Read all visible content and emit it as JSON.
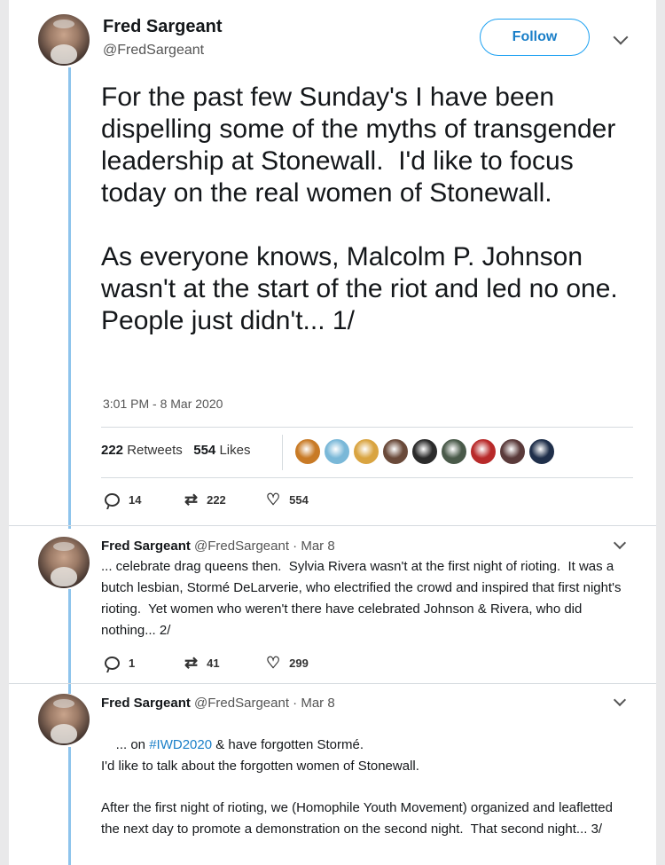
{
  "main_tweet": {
    "author_name": "Fred Sargeant",
    "author_handle": "@FredSargeant",
    "follow_label": "Follow",
    "text": "For the past few Sunday's I have been dispelling some of the myths of transgender leadership at Stonewall.  I'd like to focus today on the real women of Stonewall.\n\nAs everyone knows, Malcolm P. Johnson wasn't at the start of the riot and led no one. People just didn't... 1/",
    "timestamp": "3:01 PM - 8 Mar 2020",
    "retweets_count": "222",
    "retweets_label": "Retweets",
    "likes_count": "554",
    "likes_label": "Likes",
    "liker_colors": [
      "#c87a26",
      "#7ab8d8",
      "#d9a441",
      "#6a4a3a",
      "#2b2b2b",
      "#4a5a4a",
      "#b82a2a",
      "#5a3a3a",
      "#1f2f4a"
    ],
    "actions": {
      "replies": "14",
      "retweets": "222",
      "likes": "554"
    }
  },
  "replies": [
    {
      "author_name": "Fred Sargeant",
      "author_handle": "@FredSargeant",
      "date": "Mar 8",
      "text": "... celebrate drag queens then.  Sylvia Rivera wasn't at the first night of rioting.  It was a butch lesbian, Stormé DeLarverie, who electrified the crowd and inspired that first night's rioting.  Yet women who weren't there have celebrated Johnson & Rivera, who did nothing... 2/",
      "actions": {
        "replies": "1",
        "retweets": "41",
        "likes": "299"
      }
    },
    {
      "author_name": "Fred Sargeant",
      "author_handle": "@FredSargeant",
      "date": "Mar 8",
      "text_prefix": "... on ",
      "hashtag": "#IWD2020",
      "text_suffix": " & have forgotten Stormé.",
      "paragraph_2": "I'd like to talk about the forgotten women of Stonewall.",
      "paragraph_3": "After the first night of rioting, we (Homophile Youth Movement) organized and leafletted the next day to promote a demonstration on the second night.  That second night... 3/"
    }
  ],
  "icons": {
    "reply": "reply-icon",
    "retweet": "retweet-icon",
    "like": "heart-icon",
    "more": "chevron-down-icon"
  }
}
